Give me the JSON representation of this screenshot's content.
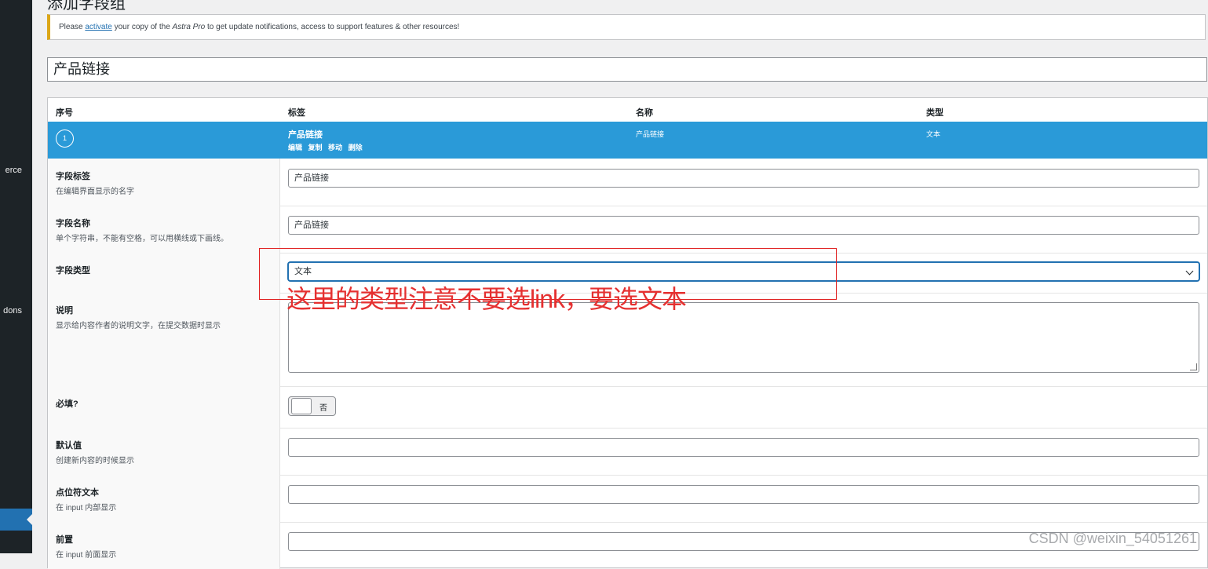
{
  "sidebar": {
    "items": [
      {
        "label": "erce"
      },
      {
        "label": "dons"
      }
    ]
  },
  "page": {
    "title": "添加字段组"
  },
  "notice": {
    "prefix": "Please ",
    "link": "activate",
    "middle": " your copy of the ",
    "product": "Astra Pro",
    "suffix": " to get update notifications, access to support features & other resources!"
  },
  "group_title": "产品链接",
  "table": {
    "headers": [
      "序号",
      "标签",
      "名称",
      "类型"
    ]
  },
  "field_row": {
    "order": "1",
    "label": "产品链接",
    "actions": [
      "编辑",
      "复制",
      "移动",
      "删除"
    ],
    "name": "产品链接",
    "type": "文本"
  },
  "settings": {
    "label": {
      "title": "字段标签",
      "desc": "在编辑界面显示的名字",
      "value": "产品链接"
    },
    "name": {
      "title": "字段名称",
      "desc": "单个字符串，不能有空格，可以用横线或下画线。",
      "value": "产品链接"
    },
    "type": {
      "title": "字段类型",
      "value": "文本"
    },
    "instructions": {
      "title": "说明",
      "desc": "显示给内容作者的说明文字，在提交数据时显示"
    },
    "required": {
      "title": "必填?",
      "toggle_text": "否"
    },
    "default": {
      "title": "默认值",
      "desc": "创建新内容的时候显示"
    },
    "placeholder": {
      "title": "点位符文本",
      "desc": "在 input 内部显示"
    },
    "prepend": {
      "title": "前置",
      "desc": "在 input 前面显示"
    }
  },
  "annotation": {
    "text": "这里的类型注意不要选link，要选文本",
    "color": "#e02020"
  },
  "watermark": "CSDN @weixin_54051261"
}
